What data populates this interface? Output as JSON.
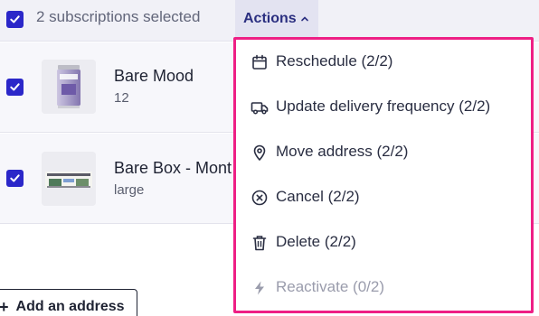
{
  "header": {
    "selection_text": "2 subscriptions selected",
    "actions_label": "Actions"
  },
  "subscriptions": [
    {
      "name": "Bare Mood",
      "detail": "12"
    },
    {
      "name": "Bare Box - Mont",
      "detail": "large"
    }
  ],
  "add_address_label": "Add an address",
  "menu": {
    "items": [
      {
        "label": "Reschedule (2/2)",
        "icon": "calendar-icon",
        "enabled": true
      },
      {
        "label": "Update delivery frequency (2/2)",
        "icon": "truck-icon",
        "enabled": true
      },
      {
        "label": "Move address (2/2)",
        "icon": "map-pin-icon",
        "enabled": true
      },
      {
        "label": "Cancel (2/2)",
        "icon": "x-circle-icon",
        "enabled": true
      },
      {
        "label": "Delete (2/2)",
        "icon": "trash-icon",
        "enabled": true
      },
      {
        "label": "Reactivate (0/2)",
        "icon": "lightning-icon",
        "enabled": false
      }
    ]
  },
  "colors": {
    "accent": "#2b27c9",
    "highlight_border": "#ee1f85",
    "header_bg": "#f1f1f7"
  }
}
